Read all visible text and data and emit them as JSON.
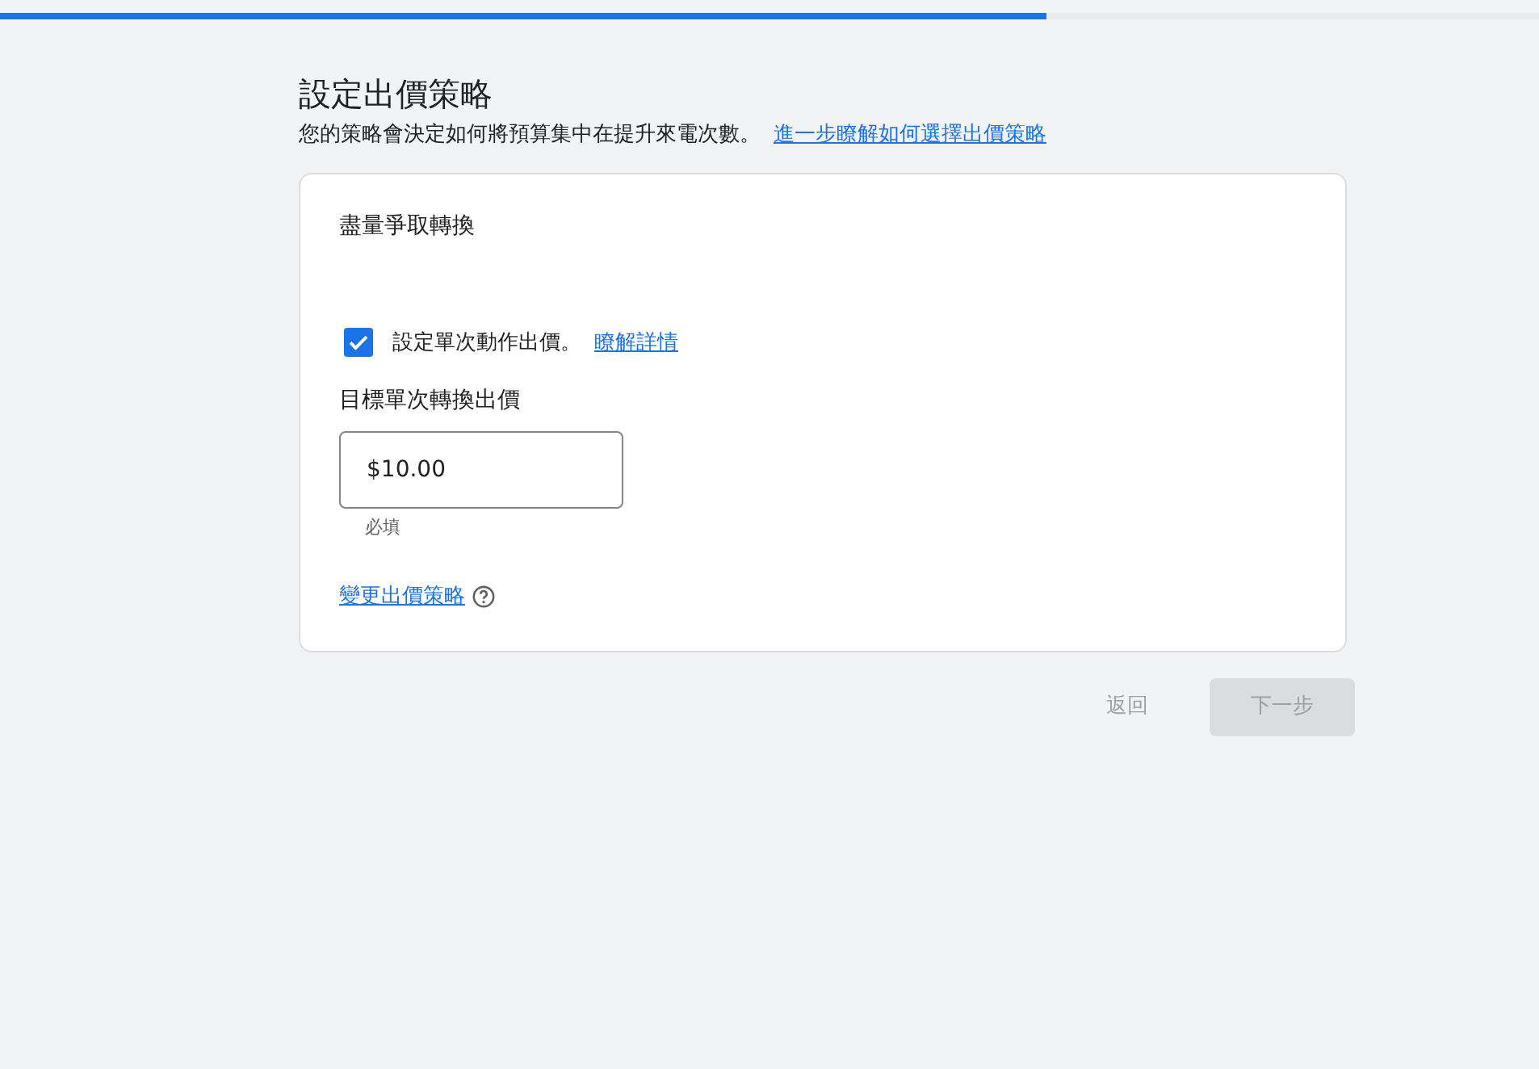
{
  "progress": {
    "level": 0.68
  },
  "header": {
    "title": "設定出價策略",
    "description": "您的策略會決定如何將預算集中在提升來電次數。",
    "link": "進一步瞭解如何選擇出價策略"
  },
  "card": {
    "strategy": "盡量爭取轉換",
    "checkbox": {
      "label": "設定單次動作出價。",
      "link": "瞭解詳情",
      "checked": true
    },
    "field": {
      "label": "目標單次轉換出價",
      "value": "$10.00",
      "helper": "必填"
    },
    "change_link": "變更出價策略"
  },
  "buttons": [
    {
      "label": "返回",
      "kind": "text",
      "disabled": true
    },
    {
      "label": "下一步",
      "kind": "filled",
      "disabled": true
    }
  ]
}
